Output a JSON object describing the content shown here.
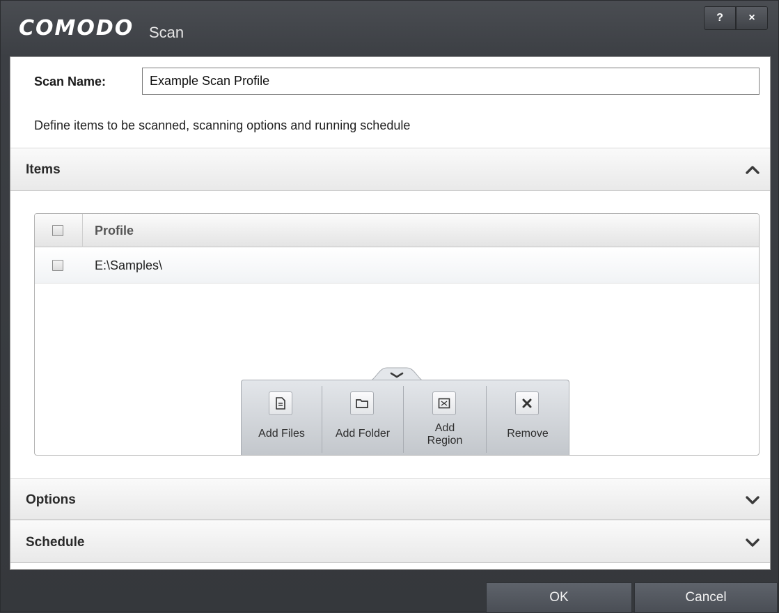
{
  "window": {
    "brand": "COMODO",
    "title": "Scan",
    "help_label": "?",
    "close_label": "×"
  },
  "form": {
    "scan_name_label": "Scan Name:",
    "scan_name_value": "Example Scan Profile",
    "description": "Define items to be scanned, scanning options and running schedule"
  },
  "sections": {
    "items": {
      "label": "Items",
      "expanded": true
    },
    "options": {
      "label": "Options",
      "expanded": false
    },
    "schedule": {
      "label": "Schedule",
      "expanded": false
    }
  },
  "items_table": {
    "column_header": "Profile",
    "rows": [
      {
        "path": "E:\\Samples\\",
        "checked": false
      }
    ]
  },
  "toolbar": {
    "add_files": "Add Files",
    "add_folder": "Add Folder",
    "add_region_line1": "Add",
    "add_region_line2": "Region",
    "remove": "Remove"
  },
  "footer": {
    "ok": "OK",
    "cancel": "Cancel"
  }
}
